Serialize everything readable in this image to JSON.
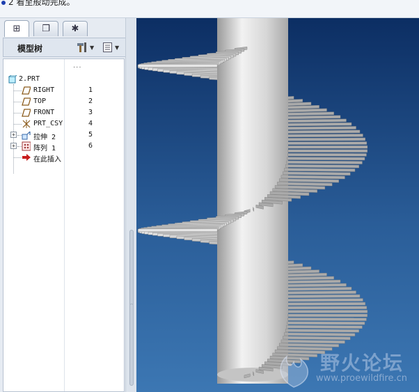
{
  "message": {
    "text": "2 看至般动完成。"
  },
  "tabs": [
    {
      "icon": "model-tree-tab-icon",
      "glyph": "⊞"
    },
    {
      "icon": "folder-browser-tab-icon",
      "glyph": "❐"
    },
    {
      "icon": "favorites-tab-icon",
      "glyph": "✱"
    }
  ],
  "tree": {
    "title": "模型树",
    "settings_icon": "tools-settings-icon",
    "show_icon": "list-show-icon",
    "column_header": "...",
    "items": [
      {
        "label": "2.PRT",
        "num": "",
        "icon": "part-icon"
      },
      {
        "label": "RIGHT",
        "num": "1",
        "icon": "datum-plane-icon"
      },
      {
        "label": "TOP",
        "num": "2",
        "icon": "datum-plane-icon"
      },
      {
        "label": "FRONT",
        "num": "3",
        "icon": "datum-plane-icon"
      },
      {
        "label": "PRT_CSY",
        "num": "4",
        "icon": "coordinate-system-icon"
      },
      {
        "label": "拉伸 2",
        "num": "5",
        "icon": "extrude-icon"
      },
      {
        "label": "阵列 1",
        "num": "6",
        "icon": "pattern-icon"
      },
      {
        "label": "在此插入",
        "num": "",
        "icon": "insert-here-arrow-icon"
      }
    ]
  },
  "watermark": {
    "title": "野火论坛",
    "url": "www.proewildfire.cn"
  },
  "colors": {
    "viewport_top": "#0c2e63",
    "viewport_bottom": "#3c77b3",
    "model": "#d9d9d9"
  }
}
